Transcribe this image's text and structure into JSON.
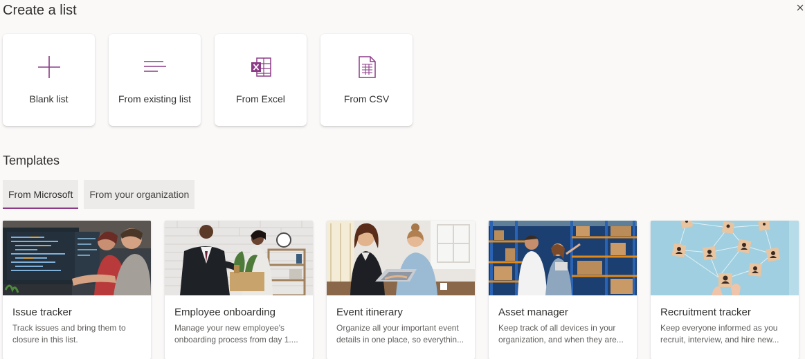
{
  "header": {
    "title": "Create a list",
    "close_icon": "close-icon"
  },
  "create_options": [
    {
      "label": "Blank list",
      "icon": "plus-icon"
    },
    {
      "label": "From existing list",
      "icon": "list-lines-icon"
    },
    {
      "label": "From Excel",
      "icon": "excel-icon"
    },
    {
      "label": "From CSV",
      "icon": "csv-file-icon"
    }
  ],
  "templates_section": {
    "title": "Templates",
    "tabs": [
      {
        "label": "From Microsoft",
        "selected": true
      },
      {
        "label": "From your organization",
        "selected": false
      }
    ],
    "items": [
      {
        "name": "Issue tracker",
        "description": "Track issues and bring them to closure in this list."
      },
      {
        "name": "Employee onboarding",
        "description": "Manage your new employee's onboarding process from day 1...."
      },
      {
        "name": "Event itinerary",
        "description": "Organize all your important event details in one place, so everythin..."
      },
      {
        "name": "Asset manager",
        "description": "Keep track of all devices in your organization, and when they are..."
      },
      {
        "name": "Recruitment tracker",
        "description": "Keep everyone informed as you recruit, interview, and hire new..."
      }
    ]
  },
  "colors": {
    "accent": "#8c3a87",
    "background": "#faf9f8",
    "card": "#ffffff"
  }
}
